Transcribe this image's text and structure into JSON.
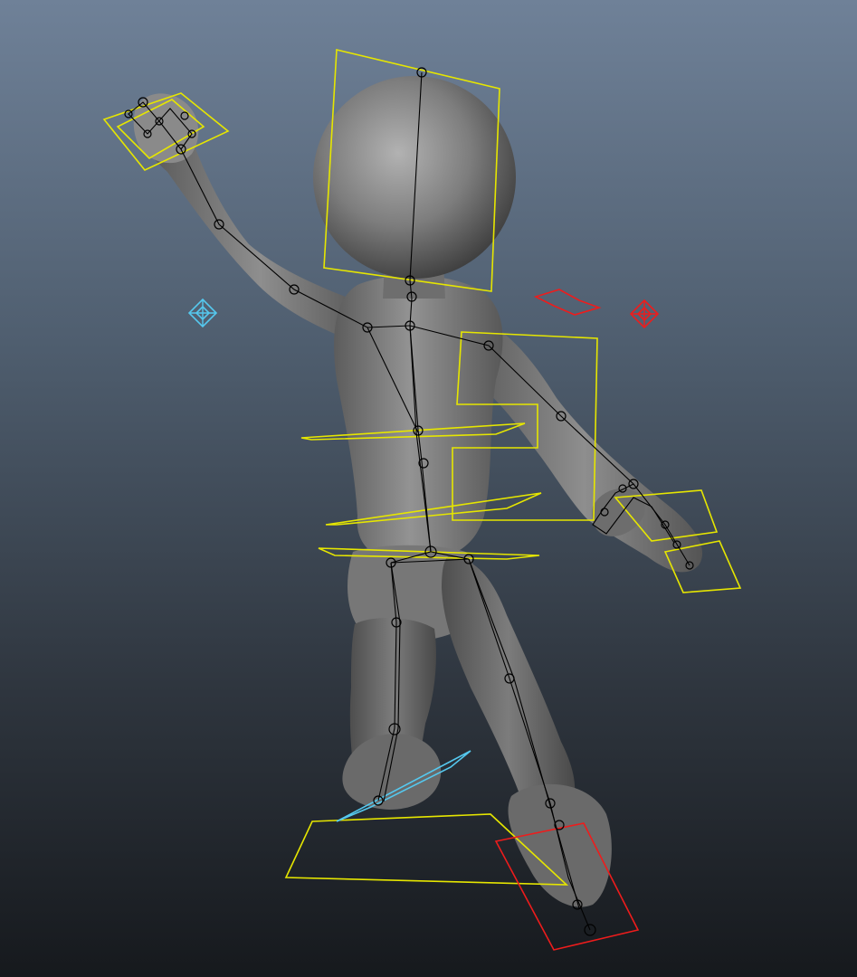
{
  "viewport": {
    "background_top": "#6f8198",
    "background_bottom": "#16191d"
  },
  "colors": {
    "mesh": "#7a7a7a",
    "mesh_highlight": "#b0b0b0",
    "skeleton": "#000000",
    "control_default": "#e6e600",
    "control_left": "#55c8ee",
    "control_right": "#ee1c1c"
  },
  "scene": {
    "character": "character-mesh",
    "skeleton": "joint-hierarchy",
    "controls": [
      "head-control",
      "chest-control",
      "spine-control",
      "hip-control",
      "left-hand-control",
      "right-hand-control",
      "left-foot-control",
      "right-foot-control",
      "left-pole-vector-icon",
      "right-pole-vector-icon"
    ]
  }
}
